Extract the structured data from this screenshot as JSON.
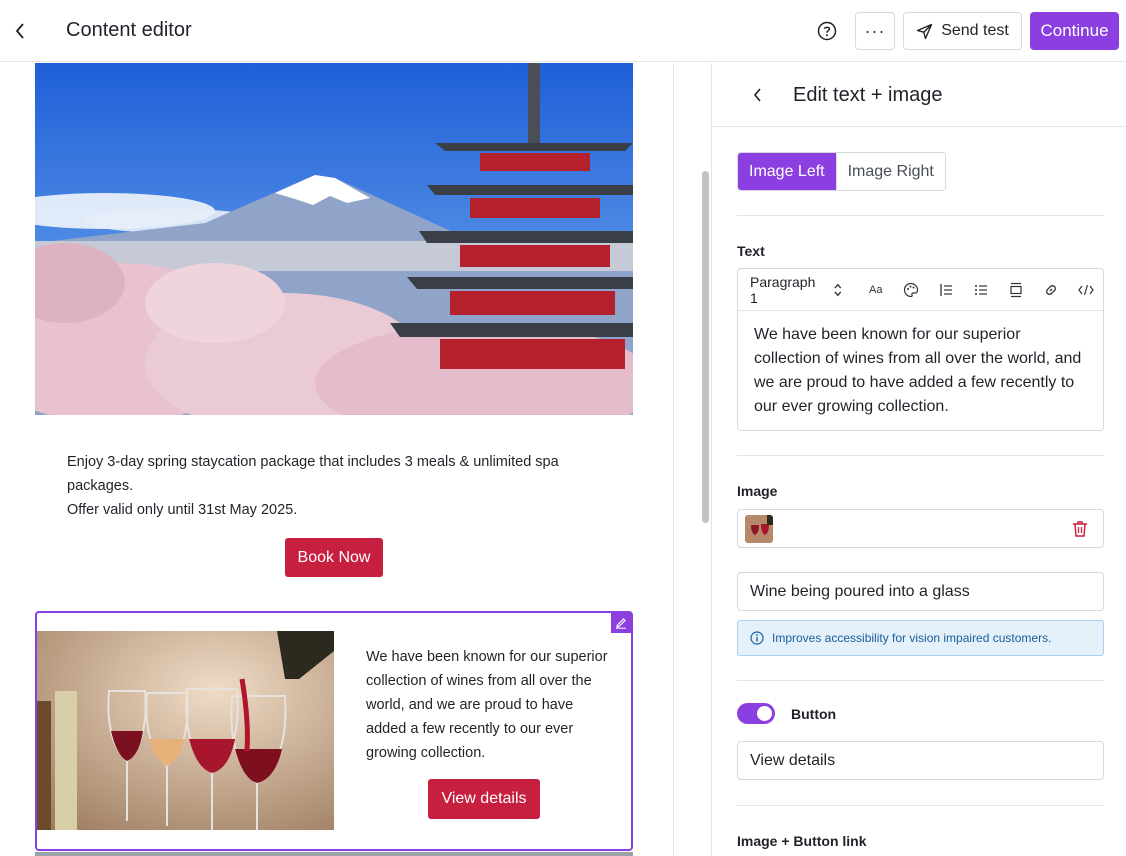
{
  "header": {
    "title": "Content editor",
    "more_label": "···",
    "send_test_label": "Send test",
    "continue_label": "Continue"
  },
  "canvas": {
    "promo_text_line1": "Enjoy 3-day spring staycation package that includes 3 meals & unlimited spa packages.",
    "promo_text_line2": "Offer valid only until 31st May 2025.",
    "book_button": "Book Now",
    "block_text": "We have been known for our superior collection of wines from all over the world, and we are proud to have added a few recently to our ever growing collection.",
    "view_button": "View details"
  },
  "panel": {
    "title": "Edit text + image",
    "layout_options": [
      "Image Left",
      "Image Right"
    ],
    "text_label": "Text",
    "paragraph_style": "Paragraph 1",
    "font_size_icon": "Aa",
    "text_content": "We have been known for our superior collection of wines from all over the world, and we are proud to have added a few recently to our ever growing collection.",
    "image_label": "Image",
    "alt_text_value": "Wine being poured into a glass",
    "info_text": "Improves accessibility for vision impaired customers.",
    "button_label": "Button",
    "button_text_value": "View details",
    "link_label": "Image + Button link"
  },
  "colors": {
    "accent": "#8b3fe0",
    "cta": "#c61f3f",
    "info_bg": "#e4f1fb"
  }
}
